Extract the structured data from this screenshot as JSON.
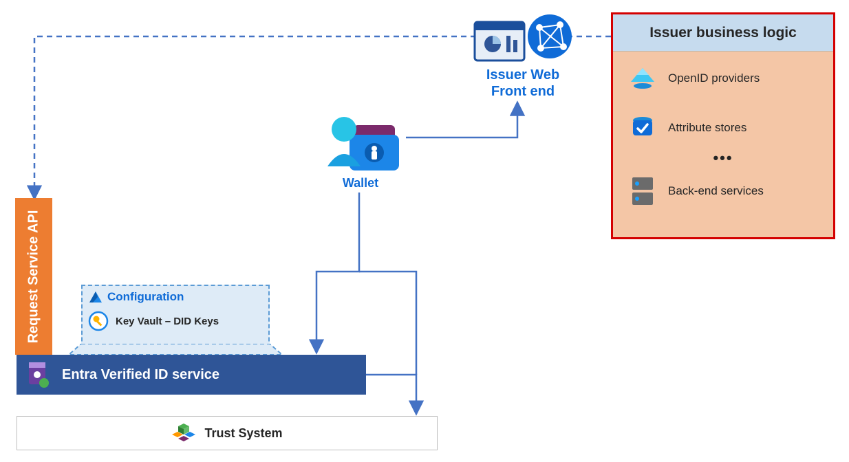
{
  "issuer_biz": {
    "title": "Issuer business logic",
    "openid": "OpenID providers",
    "attributes": "Attribute stores",
    "ellipsis": "•••",
    "backend": "Back-end services"
  },
  "frontend": {
    "label": "Issuer Web\nFront end"
  },
  "wallet": {
    "label": "Wallet"
  },
  "request_api": {
    "label": "Request Service API"
  },
  "configuration": {
    "title": "Configuration",
    "keyvault": "Key Vault – DID Keys"
  },
  "entra": {
    "label": "Entra Verified ID service"
  },
  "trust": {
    "label": "Trust  System"
  },
  "colors": {
    "azure_blue": "#0f6bd7",
    "orange": "#ed7d31",
    "dark_blue": "#2f5597",
    "red_border": "#d40000",
    "peach": "#f4c6a6",
    "light_blue": "#deebf7"
  }
}
